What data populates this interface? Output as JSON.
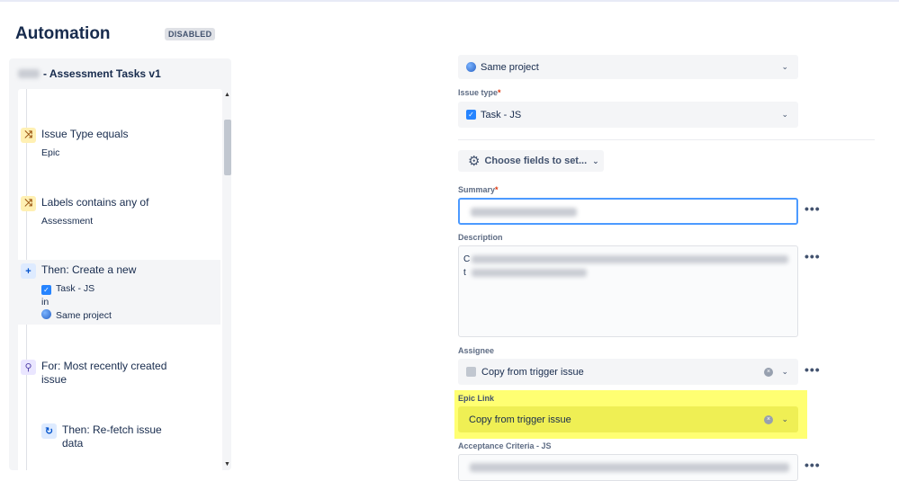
{
  "app": {
    "title": "Automation",
    "status_badge": "DISABLED"
  },
  "rule": {
    "name": "- Assessment Tasks v1",
    "components": [
      {
        "title": "Issue Type equals",
        "subtitle": "Epic",
        "icon": "shuffle-icon"
      },
      {
        "title": "Labels contains any of",
        "subtitle": "Assessment",
        "icon": "shuffle-icon"
      },
      {
        "title": "Then: Create a new",
        "issue_type": "Task - JS",
        "connector": "in",
        "project": "Same project",
        "icon": "plus-icon"
      },
      {
        "title": "For: Most recently created",
        "title2": "issue",
        "icon": "branch-icon"
      },
      {
        "title": "Then: Re-fetch issue",
        "title2": "data",
        "icon": "refresh-icon"
      }
    ]
  },
  "form": {
    "project_value": "Same project",
    "issue_type_label": "Issue type",
    "issue_type_value": "Task - JS",
    "choose_fields_label": "Choose fields to set...",
    "summary_label": "Summary",
    "description_label": "Description",
    "description_visible_chars": [
      "C",
      "t"
    ],
    "assignee_label": "Assignee",
    "assignee_value": "Copy from trigger issue",
    "epic_link_label": "Epic Link",
    "epic_link_value": "Copy from trigger issue",
    "acceptance_label": "Acceptance Criteria - JS",
    "required_mark": "*"
  },
  "colors": {
    "highlight": "#ffff66",
    "focus_border": "#4c9aff",
    "checkbox": "#2684ff"
  }
}
